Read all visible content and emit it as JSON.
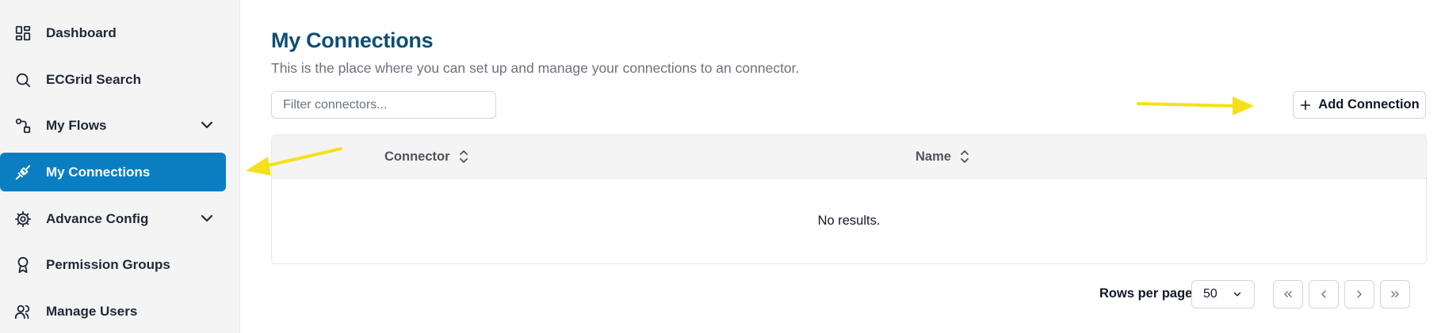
{
  "sidebar": {
    "items": [
      {
        "label": "Dashboard",
        "icon": "dashboard-icon",
        "active": false,
        "expandable": false
      },
      {
        "label": "ECGrid Search",
        "icon": "search-icon",
        "active": false,
        "expandable": false
      },
      {
        "label": "My Flows",
        "icon": "flows-icon",
        "active": false,
        "expandable": true
      },
      {
        "label": "My Connections",
        "icon": "connections-icon",
        "active": true,
        "expandable": false
      },
      {
        "label": "Advance Config",
        "icon": "gear-icon",
        "active": false,
        "expandable": true
      },
      {
        "label": "Permission Groups",
        "icon": "badge-icon",
        "active": false,
        "expandable": false
      },
      {
        "label": "Manage Users",
        "icon": "users-icon",
        "active": false,
        "expandable": false
      }
    ]
  },
  "main": {
    "title": "My Connections",
    "subtitle": "This is the place where you can set up and manage your connections to an connector.",
    "filter": {
      "placeholder": "Filter connectors...",
      "value": ""
    },
    "add_button": {
      "label": "Add Connection",
      "icon": "plus-icon"
    },
    "table": {
      "columns": [
        {
          "label": "Connector",
          "icon": "sort-icon"
        },
        {
          "label": "Name",
          "icon": "sort-icon"
        }
      ],
      "empty_text": "No results."
    },
    "pagination": {
      "rows_label": "Rows per page",
      "rows_value": "50",
      "buttons": [
        "first-page-icon",
        "prev-page-icon",
        "next-page-icon",
        "last-page-icon"
      ]
    }
  },
  "colors": {
    "accent": "#0b7ec1",
    "title": "#0e4f73",
    "annotation_arrow": "#f5e11a"
  }
}
